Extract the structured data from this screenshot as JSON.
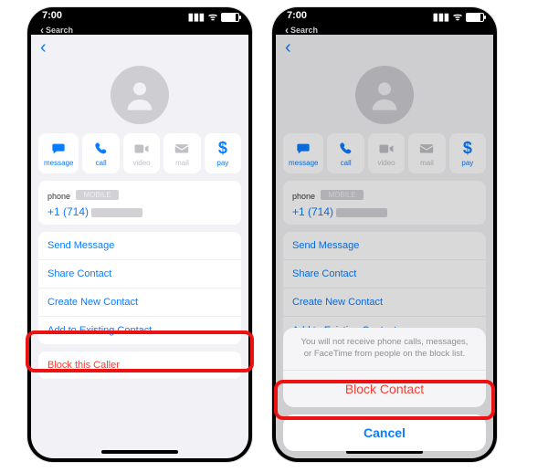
{
  "status_bar": {
    "time": "7:00",
    "back_label": "Search"
  },
  "quick": [
    {
      "name": "message",
      "label": "message",
      "active": true
    },
    {
      "name": "call",
      "label": "call",
      "active": true
    },
    {
      "name": "video",
      "label": "video",
      "active": false
    },
    {
      "name": "mail",
      "label": "mail",
      "active": false
    },
    {
      "name": "pay",
      "label": "pay",
      "active": true
    }
  ],
  "phone_card": {
    "label": "phone",
    "badge": "MOBILE",
    "number": "+1 (714)"
  },
  "actions": [
    "Send Message",
    "Share Contact",
    "Create New Contact",
    "Add to Existing Contact"
  ],
  "block_row": "Block this Caller",
  "sheet": {
    "message": "You will not receive phone calls, messages, or FaceTime from people on the block list.",
    "action": "Block Contact",
    "cancel": "Cancel"
  }
}
